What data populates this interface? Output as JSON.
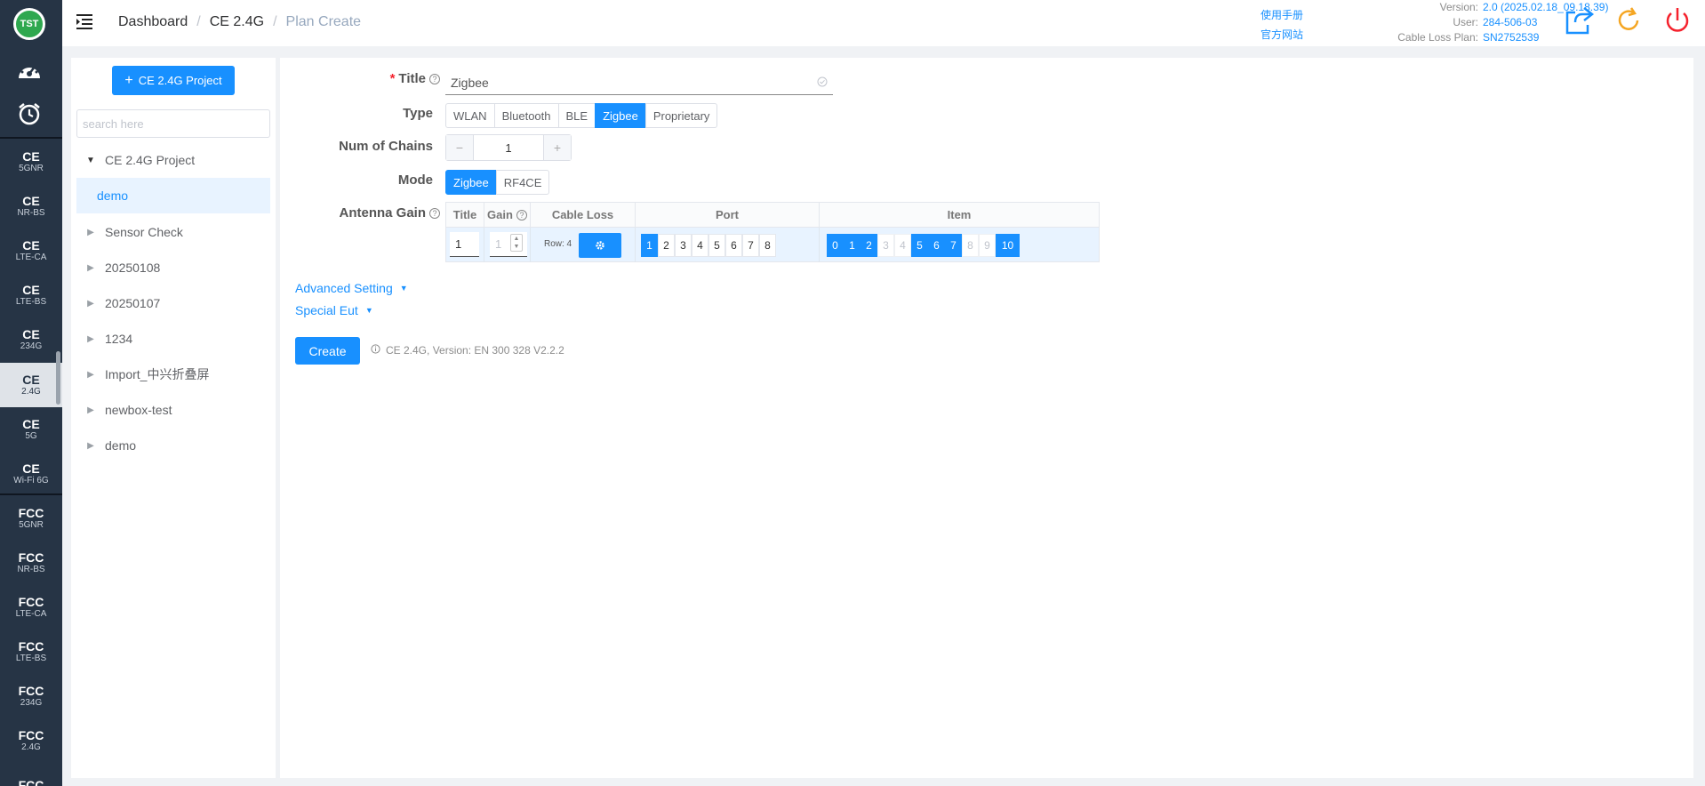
{
  "logo": {
    "text": "TST"
  },
  "rail": {
    "top_icons": [
      "dashboard-gauge-icon",
      "alarm-clock-icon"
    ],
    "items": [
      {
        "l1": "CE",
        "l2": "5GNR"
      },
      {
        "l1": "CE",
        "l2": "NR-BS"
      },
      {
        "l1": "CE",
        "l2": "LTE-CA"
      },
      {
        "l1": "CE",
        "l2": "LTE-BS"
      },
      {
        "l1": "CE",
        "l2": "234G"
      },
      {
        "l1": "CE",
        "l2": "2.4G",
        "active": true
      },
      {
        "l1": "CE",
        "l2": "5G"
      },
      {
        "l1": "CE",
        "l2": "Wi-Fi 6G"
      },
      {
        "l1": "FCC",
        "l2": "5GNR"
      },
      {
        "l1": "FCC",
        "l2": "NR-BS"
      },
      {
        "l1": "FCC",
        "l2": "LTE-CA"
      },
      {
        "l1": "FCC",
        "l2": "LTE-BS"
      },
      {
        "l1": "FCC",
        "l2": "234G"
      },
      {
        "l1": "FCC",
        "l2": "2.4G"
      },
      {
        "l1": "FCC",
        "l2": ""
      }
    ]
  },
  "header": {
    "breadcrumb": [
      "Dashboard",
      "CE 2.4G",
      "Plan Create"
    ],
    "links": {
      "manual": "使用手册",
      "website": "官方网站"
    },
    "version_label": "Version:",
    "version_value": "2.0 (2025.02.18_09.18.39)",
    "user_label": "User:",
    "user_value": "284-506-03",
    "cable_label": "Cable Loss Plan:",
    "cable_value": "SN2752539",
    "icons": {
      "export": "share-export-icon",
      "refresh": "refresh-icon",
      "power": "power-icon"
    },
    "colors": {
      "export": "#1890ff",
      "refresh": "#f5a623",
      "power": "#f5222d"
    }
  },
  "tree": {
    "new_button": "CE 2.4G Project",
    "search_placeholder": "search here",
    "nodes": [
      {
        "label": "CE 2.4G Project",
        "expanded": true
      },
      {
        "label": "demo",
        "child": true,
        "selected": true
      },
      {
        "label": "Sensor Check"
      },
      {
        "label": "20250108"
      },
      {
        "label": "20250107"
      },
      {
        "label": "1234"
      },
      {
        "label": "Import_中兴折叠屏"
      },
      {
        "label": "newbox-test"
      },
      {
        "label": "demo"
      }
    ]
  },
  "form": {
    "title_label": "Title",
    "title_value": "Zigbee",
    "type_label": "Type",
    "type_options": [
      "WLAN",
      "Bluetooth",
      "BLE",
      "Zigbee",
      "Proprietary"
    ],
    "type_selected": "Zigbee",
    "chains_label": "Num of Chains",
    "chains_value": "1",
    "mode_label": "Mode",
    "mode_options": [
      "Zigbee",
      "RF4CE"
    ],
    "mode_selected": "Zigbee",
    "antenna_label": "Antenna Gain",
    "table": {
      "headers": {
        "title": "Title",
        "gain": "Gain",
        "cable_loss": "Cable Loss",
        "port": "Port",
        "item": "Item"
      },
      "row": {
        "title": "1",
        "gain": "1",
        "cable_row": "Row: 4"
      },
      "ports": [
        {
          "n": "1",
          "on": true
        },
        {
          "n": "2"
        },
        {
          "n": "3"
        },
        {
          "n": "4"
        },
        {
          "n": "5"
        },
        {
          "n": "6"
        },
        {
          "n": "7"
        },
        {
          "n": "8"
        }
      ],
      "items": [
        {
          "n": "0",
          "state": "on"
        },
        {
          "n": "1",
          "state": "on"
        },
        {
          "n": "2",
          "state": "on"
        },
        {
          "n": "3",
          "state": "dis"
        },
        {
          "n": "4",
          "state": "dis"
        },
        {
          "n": "5",
          "state": "on"
        },
        {
          "n": "6",
          "state": "on"
        },
        {
          "n": "7",
          "state": "on"
        },
        {
          "n": "8",
          "state": "dis"
        },
        {
          "n": "9",
          "state": "dis"
        },
        {
          "n": "10",
          "state": "on"
        }
      ]
    },
    "advanced": "Advanced Setting",
    "special": "Special Eut",
    "create": "Create",
    "note": "CE 2.4G, Version: EN 300 328 V2.2.2"
  }
}
